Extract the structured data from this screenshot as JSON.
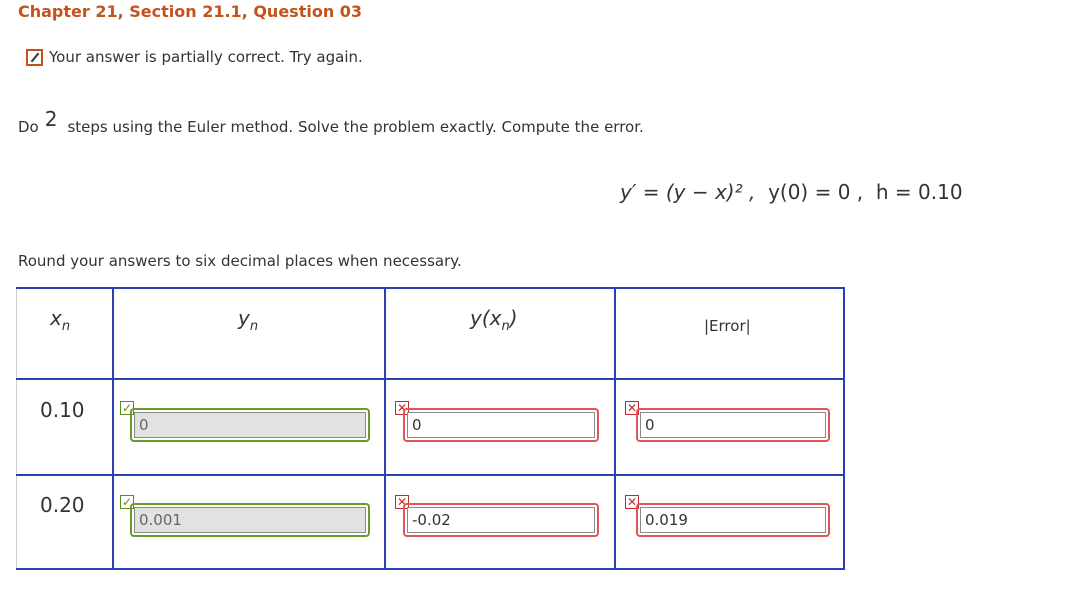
{
  "header": {
    "title": "Chapter 21, Section 21.1, Question 03"
  },
  "status": {
    "text": "Your answer is partially correct.  Try again.",
    "icon": "pencil-icon",
    "accent": "#c4521b"
  },
  "problem": {
    "prefix": "Do",
    "steps": "2",
    "text": "steps using the Euler method. Solve the problem exactly. Compute the error."
  },
  "equation": {
    "ode": "y′ = (y − x)² ,",
    "initial": "y(0) = 0 ,",
    "step": "h = 0.10"
  },
  "round_text": "Round your answers to six decimal places when necessary.",
  "table": {
    "headers": {
      "x": "x",
      "x_sub": "n",
      "y": "y",
      "y_sub": "n",
      "yx": "y(x",
      "yx_sub": "n",
      "yx_close": ")",
      "error": "|Error|"
    },
    "rows": [
      {
        "x": "0.10",
        "y_n": "0",
        "y_x": "0",
        "error": "0",
        "y_n_status": "correct",
        "y_x_status": "incorrect",
        "error_status": "incorrect"
      },
      {
        "x": "0.20",
        "y_n": "0.001",
        "y_x": "-0.02",
        "error": "0.019",
        "y_n_status": "correct",
        "y_x_status": "incorrect",
        "error_status": "incorrect"
      }
    ]
  },
  "colors": {
    "correct": "#6a9a2a",
    "incorrect": "#e05656",
    "grid": "#2b3eb5"
  }
}
